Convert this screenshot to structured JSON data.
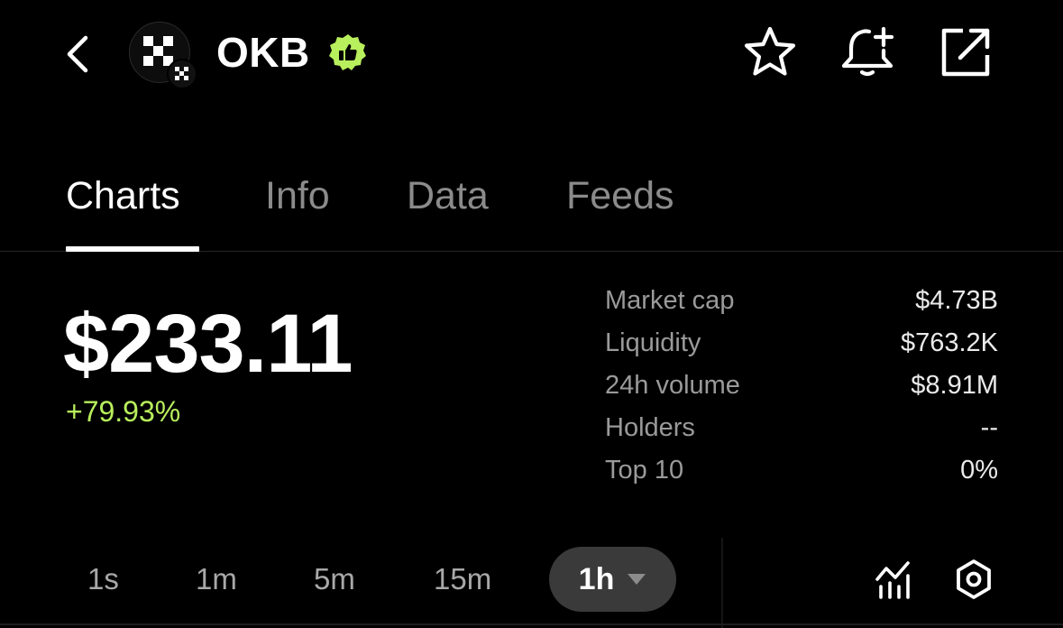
{
  "header": {
    "token_name": "OKB",
    "icons": [
      "back-chevron-icon",
      "okx-logo-icon",
      "verified-thumbs-up-icon",
      "star-icon",
      "bell-plus-icon",
      "share-external-icon"
    ],
    "verified_color": "#b8ef5c"
  },
  "tabs": [
    {
      "label": "Charts",
      "active": true
    },
    {
      "label": "Info",
      "active": false
    },
    {
      "label": "Data",
      "active": false
    },
    {
      "label": "Feeds",
      "active": false
    }
  ],
  "price": {
    "value": "$233.11",
    "change": "+79.93%",
    "change_color": "#b8ef5c"
  },
  "stats": [
    {
      "label": "Market cap",
      "value": "$4.73B"
    },
    {
      "label": "Liquidity",
      "value": "$763.2K"
    },
    {
      "label": "24h volume",
      "value": "$8.91M"
    },
    {
      "label": "Holders",
      "value": "--"
    },
    {
      "label": "Top 10",
      "value": "0%"
    }
  ],
  "timeframes": {
    "options": [
      "1s",
      "1m",
      "5m",
      "15m"
    ],
    "selected": "1h"
  },
  "tools": [
    "indicator-chart-icon",
    "settings-hexagon-icon"
  ]
}
